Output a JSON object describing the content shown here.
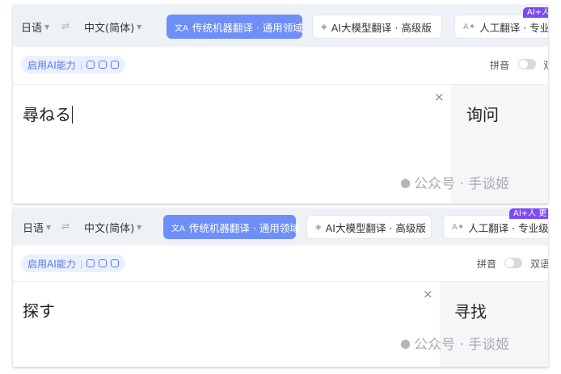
{
  "panels": [
    {
      "source_lang": "日语",
      "target_lang": "中文(简体)",
      "swap_icon": "⇌",
      "tabs": [
        {
          "label": "传统机器翻译 · 通用领域",
          "icon": "文A"
        },
        {
          "label": "AI大模型翻译 · 高级版",
          "icon": "◈"
        },
        {
          "label": "人工翻译 · 专业",
          "icon": "A✦"
        }
      ],
      "badge": "AI+人",
      "ai_label": "启用AI能力",
      "pinyin_label": "拼音",
      "dual_label": "双",
      "input_text": "尋ねる",
      "clear_icon": "×",
      "output_text": "询问",
      "watermark": "公众号 · 手谈姬"
    },
    {
      "source_lang": "日语",
      "target_lang": "中文(简体)",
      "swap_icon": "⇌",
      "tabs": [
        {
          "label": "传统机器翻译 · 通用领域",
          "icon": "文A"
        },
        {
          "label": "AI大模型翻译 · 高级版",
          "icon": "◈"
        },
        {
          "label": "人工翻译 · 专业级",
          "icon": "A✦"
        }
      ],
      "badge": "AI+人 更",
      "ai_label": "启用AI能力",
      "pinyin_label": "拼音",
      "dual_label": "双语",
      "input_text": "探す",
      "clear_icon": "×",
      "output_text": "寻找",
      "watermark": "公众号 · 手谈姬"
    }
  ],
  "colors": {
    "accent": "#6e8ff7",
    "badge": "#7b4cf2",
    "ai_pill_text": "#5a78e6"
  }
}
